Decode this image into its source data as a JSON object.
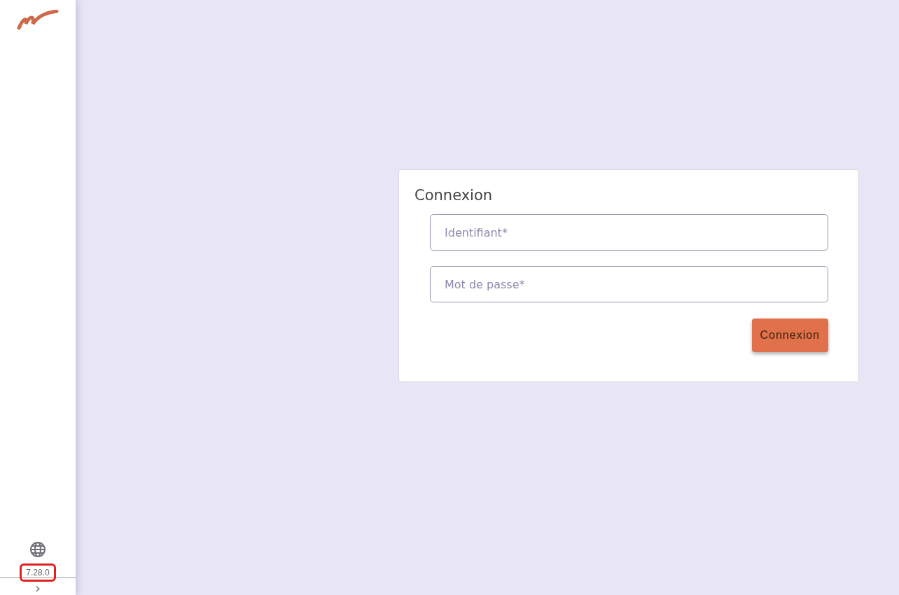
{
  "sidebar": {
    "version": "7.28.0",
    "expand_symbol": "›"
  },
  "login": {
    "title": "Connexion",
    "fields": [
      {
        "placeholder": "Identifiant*"
      },
      {
        "placeholder": "Mot de passe*"
      }
    ],
    "submit": "Connexion"
  }
}
